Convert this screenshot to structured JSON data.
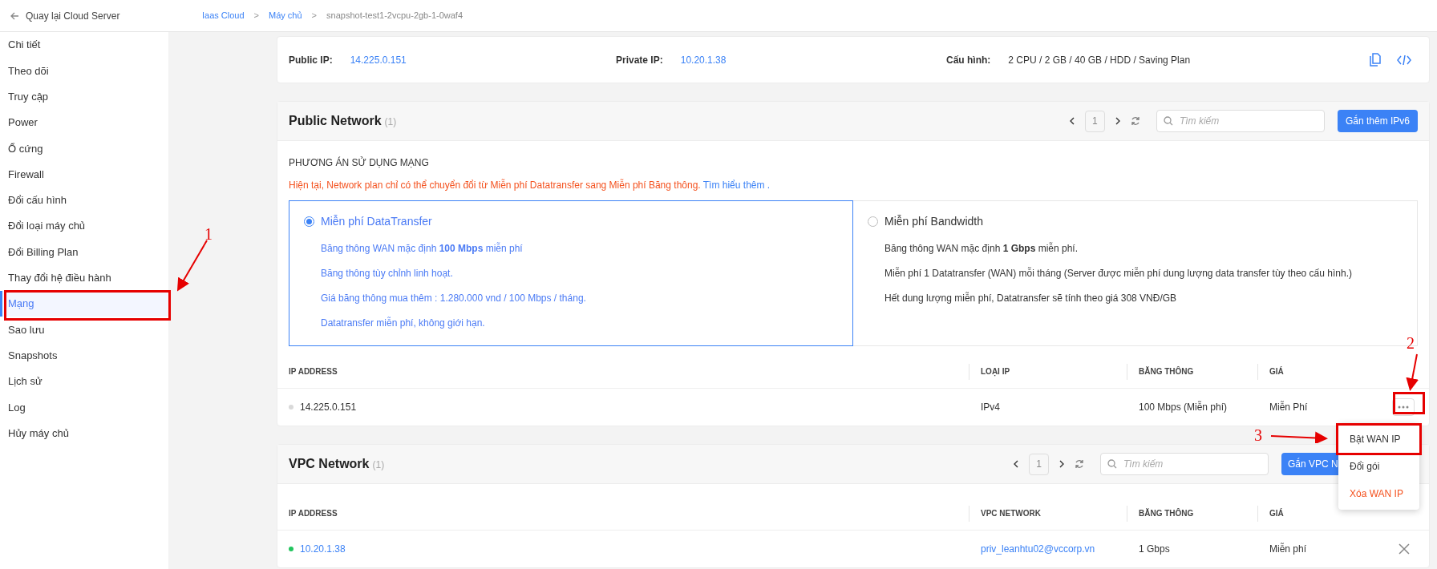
{
  "back_link": "Quay lại Cloud Server",
  "breadcrumb": [
    {
      "label": "Iaas Cloud",
      "kind": "link"
    },
    {
      "label": ">",
      "kind": "separator"
    },
    {
      "label": "Máy chủ",
      "kind": "link"
    },
    {
      "label": ">",
      "kind": "separator"
    },
    {
      "label": "snapshot-test1-2vcpu-2gb-1-0waf4",
      "kind": "current"
    }
  ],
  "sidebar": {
    "items": [
      {
        "label": "Chi tiết",
        "selected": false
      },
      {
        "label": "Theo dõi",
        "selected": false
      },
      {
        "label": "Truy cập",
        "selected": false
      },
      {
        "label": "Power",
        "selected": false
      },
      {
        "label": "Ổ cứng",
        "selected": false
      },
      {
        "label": "Firewall",
        "selected": false
      },
      {
        "label": "Đổi cấu hình",
        "selected": false
      },
      {
        "label": "Đổi loại máy chủ",
        "selected": false
      },
      {
        "label": "Đổi Billing Plan",
        "selected": false
      },
      {
        "label": "Thay đổi hệ điều hành",
        "selected": false
      },
      {
        "label": "Mạng",
        "selected": true
      },
      {
        "label": "Sao lưu",
        "selected": false
      },
      {
        "label": "Snapshots",
        "selected": false
      },
      {
        "label": "Lịch sử",
        "selected": false
      },
      {
        "label": "Log",
        "selected": false
      },
      {
        "label": "Hủy máy chủ",
        "selected": false
      }
    ]
  },
  "summary": [
    {
      "label": "Public IP:",
      "value": "14.225.0.151",
      "link": true
    },
    {
      "label": "Private IP:",
      "value": "10.20.1.38",
      "link": true
    },
    {
      "label": "Cấu hình:",
      "value": "2 CPU / 2 GB / 40 GB / HDD / Saving Plan",
      "link": false
    }
  ],
  "public_network": {
    "title": "Public Network",
    "count": "(1)",
    "page": "1",
    "search_placeholder": "Tìm kiếm",
    "button": "Gắn thêm IPv6",
    "plan_heading": "PHƯƠNG ÁN SỬ DỤNG MẠNG",
    "notice": "Hiện tại, Network plan chỉ có thể chuyển đổi từ Miễn phí Datatransfer sang Miễn phí Băng thông.",
    "notice_link": "Tìm hiểu thêm .",
    "plans": [
      {
        "title": "Miễn phí DataTransfer",
        "selected": true,
        "lines": [
          "Băng thông WAN mặc định **100 Mbps** miễn phí",
          "Băng thông tùy chỉnh linh hoạt.",
          "Giá băng thông mua thêm : 1.280.000 vnd / 100 Mbps / tháng.",
          "Datatransfer miễn phí, không giới hạn."
        ]
      },
      {
        "title": "Miễn phí Bandwidth",
        "selected": false,
        "lines": [
          "Băng thông WAN mặc định **1 Gbps** miễn phí.",
          "Miễn phí 1 Datatransfer (WAN) mỗi tháng (Server được miễn phí dung lượng data transfer tùy theo cấu hình.)",
          "Hết dung lượng miễn phí, Datatransfer sẽ tính theo giá 308 VNĐ/GB"
        ]
      }
    ],
    "columns": [
      "IP ADDRESS",
      "LOẠI IP",
      "BĂNG THÔNG",
      "GIÁ"
    ],
    "rows": [
      {
        "ip": "14.225.0.151",
        "color": "#d9d9d9",
        "type": "IPv4",
        "bandwidth": "100 Mbps (Miễn phí)",
        "price": "Miễn Phí"
      }
    ]
  },
  "vpc_network": {
    "title": "VPC Network",
    "count": "(1)",
    "page": "1",
    "search_placeholder": "Tìm kiếm",
    "button": "Gắn VPC N",
    "columns": [
      "IP ADDRESS",
      "VPC NETWORK",
      "BĂNG THÔNG",
      "GIÁ"
    ],
    "rows": [
      {
        "ip": "10.20.1.38",
        "color": "#22c55e",
        "network": "priv_leanhtu02@vccorp.vn",
        "bandwidth": "1 Gbps",
        "price": "Miễn phí"
      }
    ]
  },
  "row_menu": {
    "items": [
      {
        "label": "Bật WAN IP",
        "kind": "normal"
      },
      {
        "label": "Đổi gói",
        "kind": "normal"
      },
      {
        "label": "Xóa WAN IP",
        "kind": "danger"
      }
    ]
  },
  "annotations": [
    {
      "label": "1"
    },
    {
      "label": "2"
    },
    {
      "label": "3"
    }
  ]
}
